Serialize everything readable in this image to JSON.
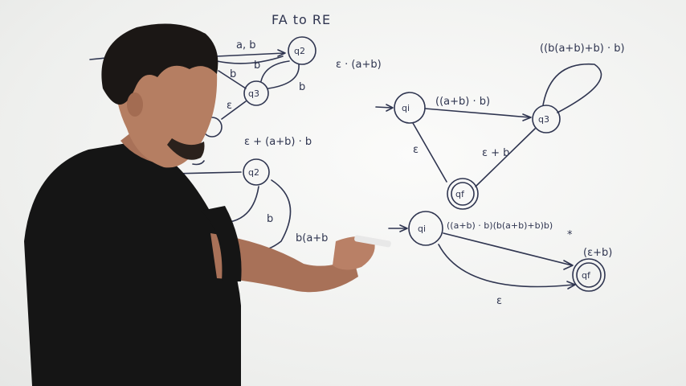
{
  "title": "FA to RE",
  "states": {
    "q2": "q2",
    "q3": "q3",
    "qi": "qi",
    "qf": "qf"
  },
  "labels": {
    "ab": "a, b",
    "b1": "b",
    "b2": "b",
    "b3": "b",
    "eps1": "ε",
    "eps_ab": "ε · (a+b)",
    "eps_plus": "ε + (a+b) · b",
    "b_loop_left": "b",
    "b_partial": "b(a+b",
    "top_loop": "((b(a+b)+b) · b)",
    "qi_q3": "((a+b) · b)",
    "eps2": "ε",
    "eps_plus_b": "ε + b",
    "long_edge": "((a+b) · b)(b(a+b)+b)b)",
    "star": "*",
    "eps_b_paren": "(ε+b)",
    "eps3": "ε"
  },
  "colors": {
    "ink": "#2f3550",
    "board": "#f2f3f1",
    "shirt": "#151515",
    "skin": "#b57e62",
    "hair": "#1b1715"
  }
}
